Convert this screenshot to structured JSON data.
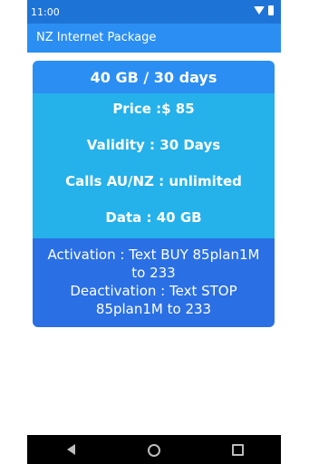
{
  "status_bar": {
    "time": "11:00",
    "icons": [
      "wifi-icon",
      "battery-icon"
    ]
  },
  "app_bar": {
    "title": "NZ Internet Package"
  },
  "package": {
    "header": "40 GB / 30 days",
    "price": "Price  :$ 85",
    "validity": "Validity : 30 Days",
    "calls": "Calls AU/NZ :  unlimited",
    "data": "Data : 40 GB",
    "activation": "Activation : Text  BUY 85plan1M\nto 233",
    "deactivation": "Deactivation : Text  STOP\n85plan1M to 233"
  },
  "nav_bar": {
    "icons": [
      "back-icon",
      "home-icon",
      "recents-icon"
    ]
  },
  "colors": {
    "status_bar": "#1e74d6",
    "app_bar": "#2b8ef3",
    "card_header": "#2b8ef3",
    "card_body": "#25b1ea",
    "card_footer": "#2a6fe4"
  }
}
